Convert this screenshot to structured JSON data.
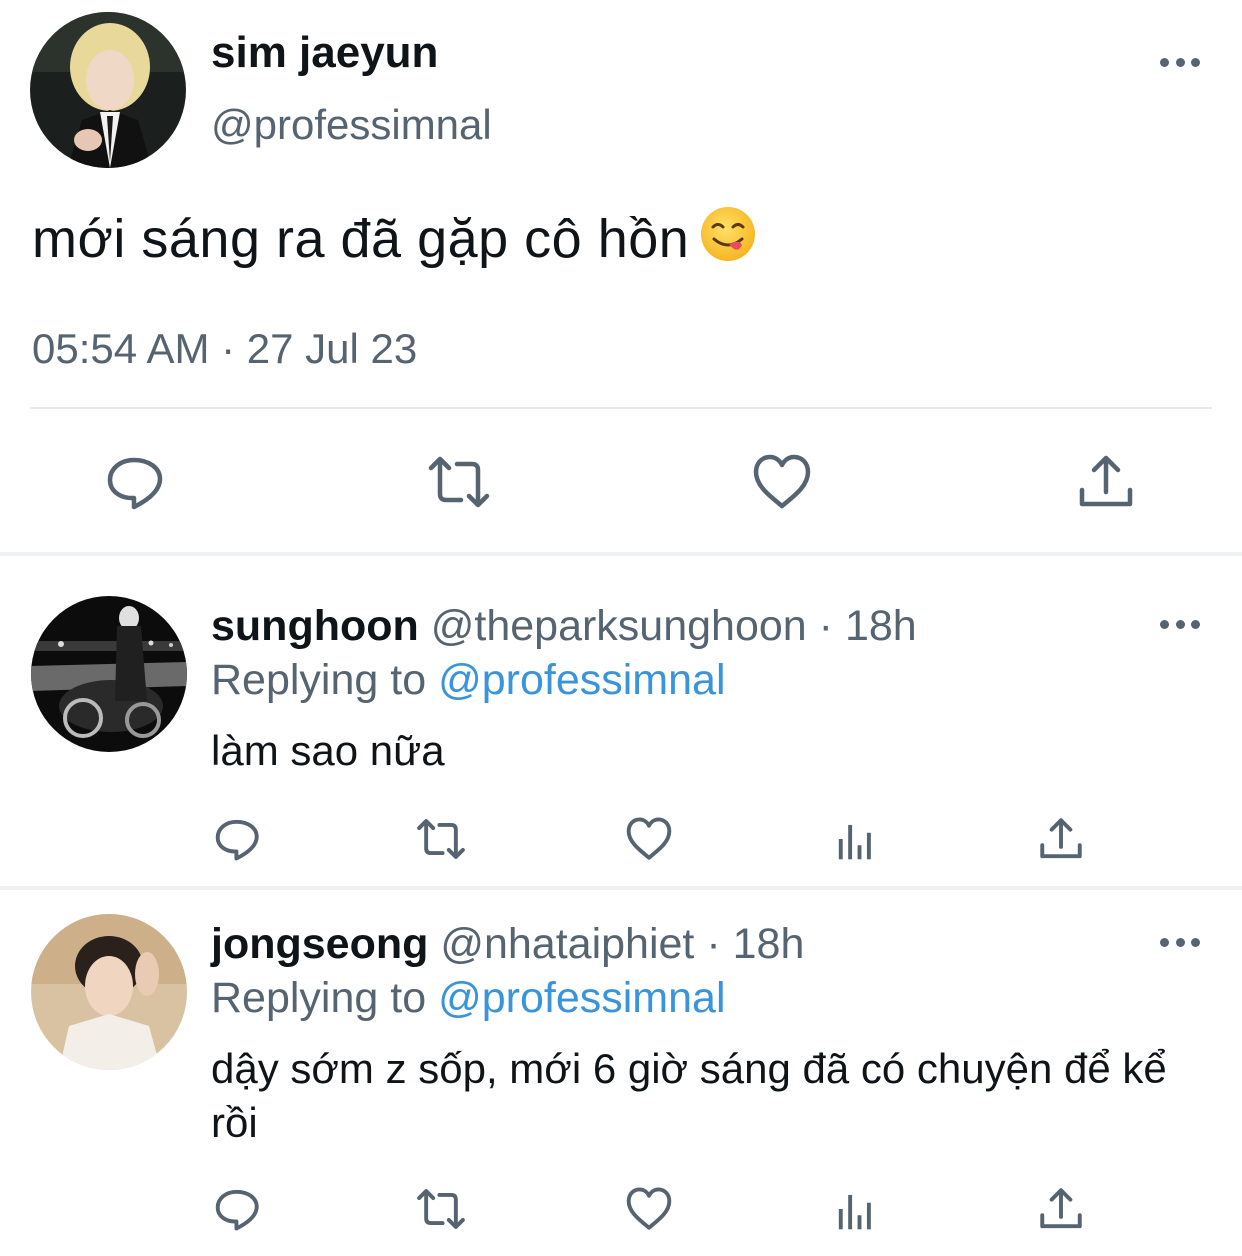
{
  "main_tweet": {
    "author_name": "sim jaeyun",
    "author_handle": "@professimnal",
    "text": "mới sáng ra đã gặp cô hồn",
    "emoji": "face-savoring-food-emoji",
    "timestamp": "05:54 AM · 27 Jul 23",
    "actions": [
      "reply-icon",
      "retweet-icon",
      "like-icon",
      "share-icon"
    ]
  },
  "replies": [
    {
      "author_name": "sunghoon",
      "author_handle": "@theparksunghoon",
      "dot": "·",
      "time": "18h",
      "replying_prefix": "Replying to ",
      "replying_to": "@professimnal",
      "text": "làm sao nữa",
      "actions": [
        "reply-icon",
        "retweet-icon",
        "like-icon",
        "analytics-icon",
        "share-icon"
      ]
    },
    {
      "author_name": "jongseong",
      "author_handle": "@nhataiphiet",
      "dot": "·",
      "time": "18h",
      "replying_prefix": "Replying to ",
      "replying_to": "@professimnal",
      "text": "dậy sớm z sốp, mới 6 giờ sáng đã có chuyện để kể rồi",
      "actions": [
        "reply-icon",
        "retweet-icon",
        "like-icon",
        "analytics-icon",
        "share-icon"
      ]
    }
  ],
  "colors": {
    "text_primary": "#0f1419",
    "text_secondary": "#566370",
    "mention_blue": "#3a94dc",
    "divider": "#e7eaec"
  }
}
